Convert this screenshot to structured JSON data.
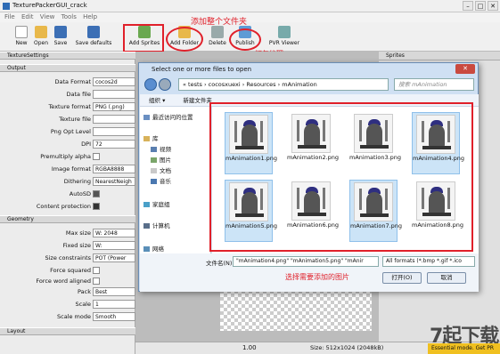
{
  "window": {
    "title": "TexturePackerGUI_crack",
    "menu": [
      "File",
      "Edit",
      "View",
      "Tools",
      "Help"
    ]
  },
  "toolbar": {
    "new": "New",
    "open": "Open",
    "save": "Save",
    "save_defaults": "Save defaults",
    "add_sprites": "Add Sprites",
    "add_folder": "Add Folder",
    "delete": "Delete",
    "publish": "Publish",
    "pvr_viewer": "PVR Viewer"
  },
  "annotations": {
    "add_folder_note": "添加整个文件夹",
    "publish_note": "打包纹理",
    "select_note": "选择需要添加的图片"
  },
  "left_panel": {
    "header": "TextureSettings",
    "output_header": "Output",
    "geometry_header": "Geometry",
    "layout_header": "Layout",
    "rows": [
      {
        "label": "Data Format",
        "value": "cocos2d"
      },
      {
        "label": "Data file",
        "value": ""
      },
      {
        "label": "Texture format",
        "value": "PNG (.png)"
      },
      {
        "label": "Texture file",
        "value": ""
      },
      {
        "label": "Png Opt Level",
        "value": ""
      },
      {
        "label": "DPI",
        "value": "72"
      },
      {
        "label": "Premultiply alpha",
        "value": ""
      },
      {
        "label": "Image format",
        "value": "RGBA8888"
      },
      {
        "label": "Dithering",
        "value": "NearestNeigh"
      },
      {
        "label": "AutoSD",
        "value": ""
      },
      {
        "label": "Content protection",
        "value": ""
      }
    ],
    "geo_rows": [
      {
        "label": "Max size",
        "value": "W: 2048"
      },
      {
        "label": "Fixed size",
        "value": "W:"
      },
      {
        "label": "Size constraints",
        "value": "POT (Power"
      },
      {
        "label": "Force squared",
        "value": ""
      },
      {
        "label": "Force word aligned",
        "value": ""
      },
      {
        "label": "Pack",
        "value": "Best"
      },
      {
        "label": "Scale",
        "value": "1"
      },
      {
        "label": "Scale mode",
        "value": "Smooth"
      }
    ]
  },
  "sprites_header": "Sprites",
  "status": {
    "zoom": "1.00",
    "size": "Size: 512x1024 (2048kB)",
    "promo": "Essential mode. Get PR"
  },
  "dialog": {
    "title": "Select one or more files to open",
    "breadcrumb": "« tests › cocosxuexi › Resources › mAnimation",
    "search_placeholder": "搜索 mAnimation",
    "organize": "组织 ▾",
    "new_folder": "新建文件夹",
    "nav_items": [
      "最近访问的位置",
      "库",
      "视频",
      "图片",
      "文档",
      "音乐",
      "家庭组",
      "计算机",
      "网络"
    ],
    "files": [
      {
        "name": "mAnimation1.png",
        "selected": true
      },
      {
        "name": "mAnimation2.png",
        "selected": false
      },
      {
        "name": "mAnimation3.png",
        "selected": false
      },
      {
        "name": "mAnimation4.png",
        "selected": true
      },
      {
        "name": "mAnimation5.png",
        "selected": true
      },
      {
        "name": "mAnimation6.png",
        "selected": false
      },
      {
        "name": "mAnimation7.png",
        "selected": true
      },
      {
        "name": "mAnimation8.png",
        "selected": false
      }
    ],
    "filename_label": "文件名(N):",
    "filename_value": "\"mAnimation4.png\" \"mAnimation5.png\" \"mAnir",
    "filter": "All formats (*.bmp *.gif *.ico",
    "open_button": "打开(O)",
    "cancel_button": "取消"
  },
  "watermark": "7起下载",
  "colors": {
    "highlight_red": "#e0202a",
    "selection_blue": "#cce4f7",
    "dialog_frame": "#cfe0f3"
  }
}
